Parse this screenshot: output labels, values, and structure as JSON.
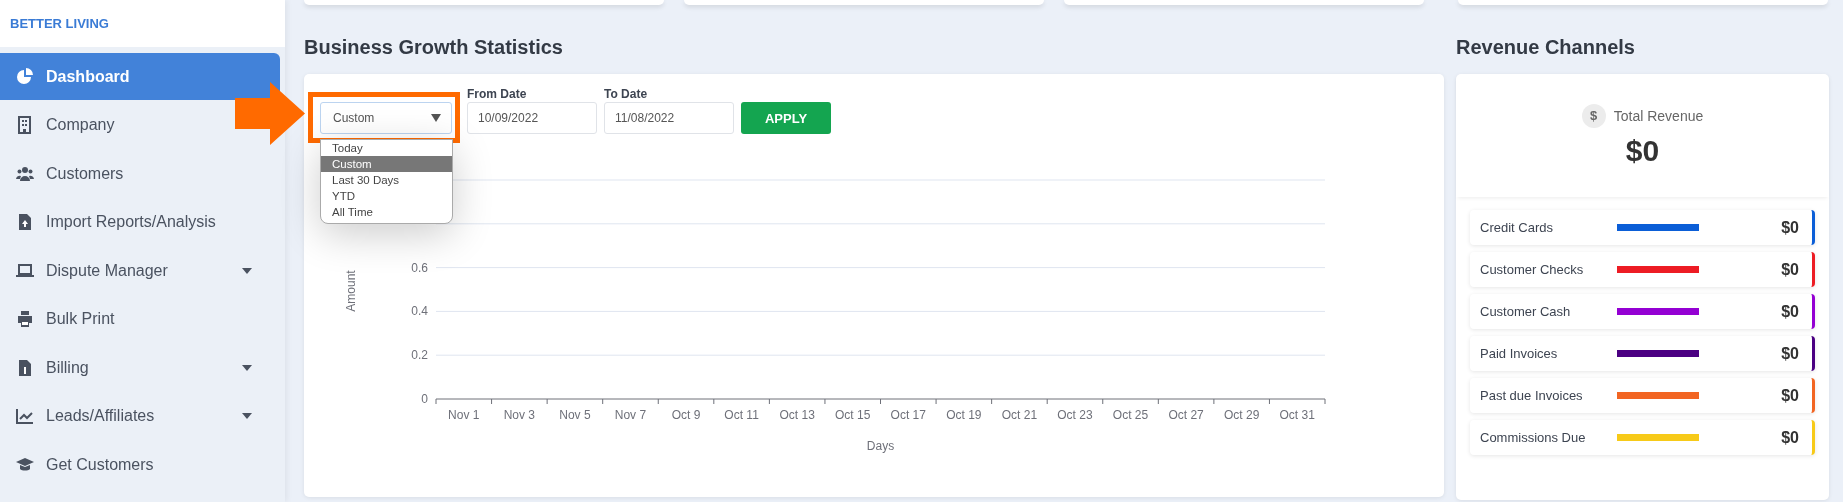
{
  "sidebar": {
    "brand": "BETTER LIVING",
    "items": [
      {
        "label": "Dashboard",
        "selected": true,
        "expandable": false
      },
      {
        "label": "Company",
        "selected": false,
        "expandable": false
      },
      {
        "label": "Customers",
        "selected": false,
        "expandable": false
      },
      {
        "label": "Import Reports/Analysis",
        "selected": false,
        "expandable": false
      },
      {
        "label": "Dispute Manager",
        "selected": false,
        "expandable": true
      },
      {
        "label": "Bulk Print",
        "selected": false,
        "expandable": false
      },
      {
        "label": "Billing",
        "selected": false,
        "expandable": true
      },
      {
        "label": "Leads/Affiliates",
        "selected": false,
        "expandable": true
      },
      {
        "label": "Get Customers",
        "selected": false,
        "expandable": false
      }
    ]
  },
  "growth": {
    "title": "Business Growth Statistics",
    "range_select": {
      "value": "Custom",
      "highlighted": true,
      "open": true,
      "options": [
        {
          "label": "Today",
          "selected": false
        },
        {
          "label": "Custom",
          "selected": true
        },
        {
          "label": "Last 30 Days",
          "selected": false
        },
        {
          "label": "YTD",
          "selected": false
        },
        {
          "label": "All Time",
          "selected": false
        }
      ]
    },
    "from_date": {
      "label": "From Date",
      "value": "10/09/2022"
    },
    "to_date": {
      "label": "To Date",
      "value": "11/08/2022"
    },
    "apply_button": "APPLY",
    "chart_data": {
      "type": "line",
      "xlabel": "Days",
      "ylabel": "Amount",
      "categories": [
        "Nov 1",
        "Nov 3",
        "Nov 5",
        "Nov 7",
        "Oct 9",
        "Oct 11",
        "Oct 13",
        "Oct 15",
        "Oct 17",
        "Oct 19",
        "Oct 21",
        "Oct 23",
        "Oct 25",
        "Oct 27",
        "Oct 29",
        "Oct 31"
      ],
      "ylim": [
        0,
        1
      ],
      "grid": true,
      "yticks": [
        0,
        0.2,
        0.4,
        0.6
      ]
    }
  },
  "revenue": {
    "title": "Revenue Channels",
    "total_label": "Total Revenue",
    "total_icon": "$",
    "total": "$0",
    "channels": [
      {
        "label": "Credit Cards",
        "amount": "$0",
        "color": "#0b5ed7"
      },
      {
        "label": "Customer Checks",
        "amount": "$0",
        "color": "#ed1c24"
      },
      {
        "label": "Customer Cash",
        "amount": "$0",
        "color": "#9400d3"
      },
      {
        "label": "Paid Invoices",
        "amount": "$0",
        "color": "#4b0082"
      },
      {
        "label": "Past due Invoices",
        "amount": "$0",
        "color": "#f26522"
      },
      {
        "label": "Commissions Due",
        "amount": "$0",
        "color": "#f7ca18"
      }
    ]
  }
}
